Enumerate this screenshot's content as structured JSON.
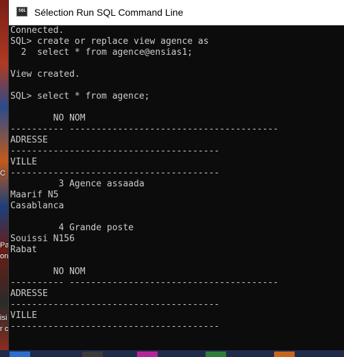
{
  "window": {
    "title": "Sélection Run SQL Command Line",
    "icon_name": "sql-console-icon",
    "icon_text": "SQL"
  },
  "desktop": {
    "glyphs": [
      "C",
      "Pa",
      "on",
      "isi",
      "r c"
    ]
  },
  "colors": {
    "console_background": "#0c0c0c",
    "console_text": "#cccccc",
    "titlebar_background": "#ffffff"
  },
  "console": {
    "lines": [
      "Connected.",
      "SQL> create or replace view agence as",
      "  2  select * from agence@ensias1;",
      "",
      "View created.",
      "",
      "SQL> select * from agence;",
      "",
      "        NO NOM",
      "---------- ---------------------------------------",
      "ADRESSE",
      "---------------------------------------",
      "VILLE",
      "---------------------------------------",
      "         3 Agence assaada",
      "Maarif N5",
      "Casablanca",
      "",
      "         4 Grande poste",
      "Souissi N156",
      "Rabat",
      "",
      "        NO NOM",
      "---------- ---------------------------------------",
      "ADRESSE",
      "---------------------------------------",
      "VILLE",
      "---------------------------------------"
    ]
  }
}
